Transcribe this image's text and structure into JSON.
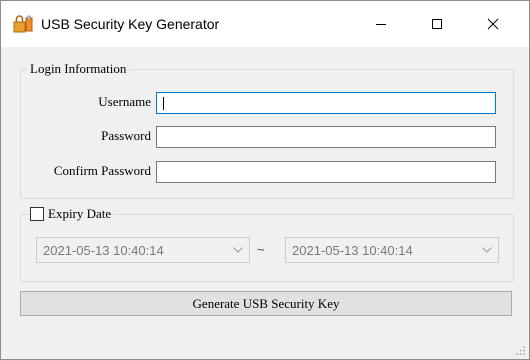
{
  "window": {
    "title": "USB Security Key Generator",
    "icon": "usb-lock-icon"
  },
  "controls": {
    "minimize": "minimize-icon",
    "maximize": "maximize-icon",
    "close": "close-icon"
  },
  "login": {
    "group_title": "Login Information",
    "username_label": "Username",
    "username_value": "",
    "password_label": "Password",
    "password_value": "",
    "confirm_label": "Confirm Password",
    "confirm_value": ""
  },
  "expiry": {
    "label": "Expiry Date",
    "checked": false,
    "start_value": "2021-05-13 10:40:14",
    "separator": "~",
    "end_value": "2021-05-13 10:40:14"
  },
  "actions": {
    "generate_label": "Generate USB Security Key"
  },
  "colors": {
    "focus_border": "#0078d7",
    "window_bg": "#f0f0f0",
    "title_bg": "#ffffff"
  }
}
